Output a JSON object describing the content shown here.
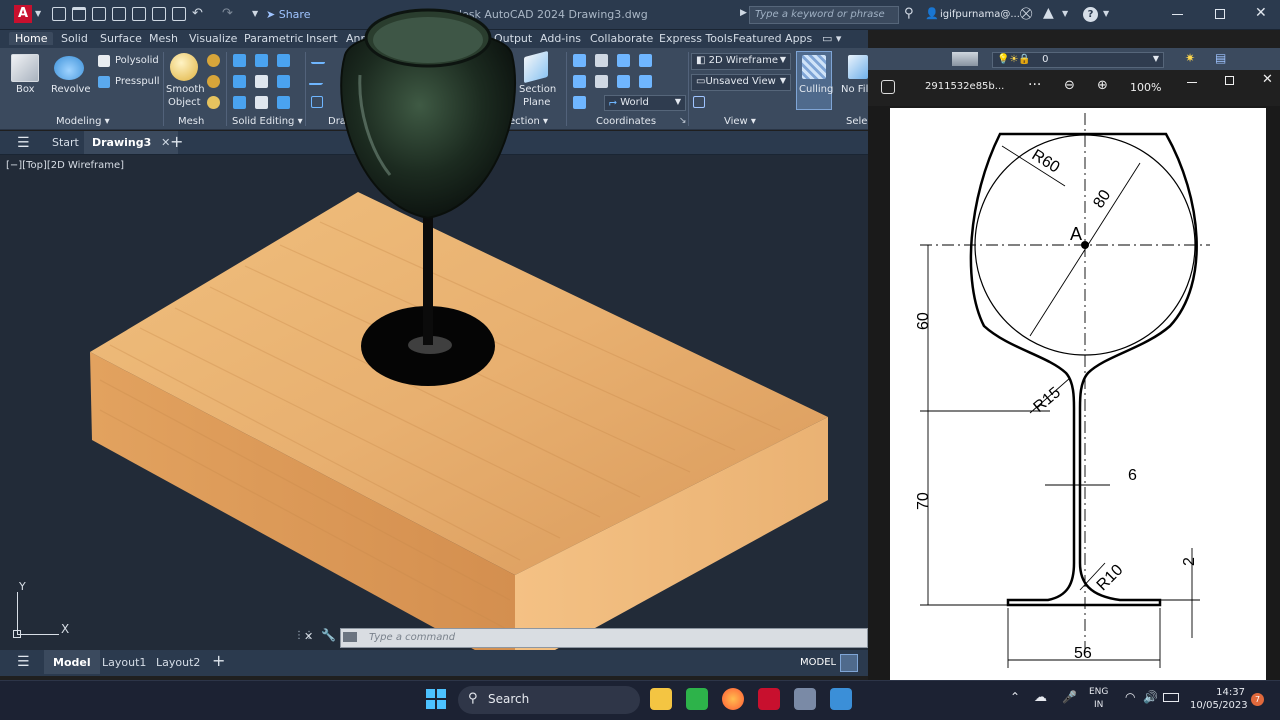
{
  "app": {
    "title": "Autodesk AutoCAD 2024  Drawing3.dwg",
    "title_visible": "desk AutoCAD 2024    Drawing3.dwg",
    "logo": "A",
    "share": "Share",
    "search_placeholder": "Type a keyword or phrase",
    "user": "igifpurnama@...",
    "help": "?"
  },
  "ribbon_tabs": [
    "Home",
    "Solid",
    "Surface",
    "Mesh",
    "Visualize",
    "Parametric",
    "Insert",
    "Ann",
    "Output",
    "Add-ins",
    "Collaborate",
    "Express Tools",
    "Featured Apps"
  ],
  "ribbon": {
    "box": "Box",
    "revolve": "Revolve",
    "polysolid": "Polysolid",
    "presspull": "Presspull",
    "smooth_object_1": "Smooth",
    "smooth_object_2": "Object",
    "section_plane_1": "Section",
    "section_plane_2": "Plane",
    "visual_style": "2D Wireframe",
    "view_state": "Unsaved View",
    "ucs": "World",
    "culling": "Culling",
    "no_filter": "No Fil",
    "layer": "0",
    "groups": {
      "modeling": "Modeling",
      "mesh": "Mesh",
      "solid_editing": "Solid Editing",
      "draw": "Dra",
      "section": "ection",
      "coordinates": "Coordinates",
      "view": "View",
      "selection": "Selec"
    }
  },
  "doc_tabs": {
    "start": "Start",
    "drawing": "Drawing3"
  },
  "viewport": {
    "label": "[−][Top][2D Wireframe]",
    "ucs_y": "Y",
    "ucs_x": "X"
  },
  "command_placeholder": "Type a command",
  "layout_tabs": [
    "Model",
    "Layout1",
    "Layout2"
  ],
  "status": {
    "model": "MODEL"
  },
  "pdf": {
    "filename": "2911532e85b...",
    "more": "···",
    "zoom": "100%"
  },
  "drawing": {
    "r60": "R60",
    "d80": "80",
    "point_a": "A",
    "dim60": "60",
    "r15": "R15",
    "dim6": "6",
    "dim70": "70",
    "r10": "R10",
    "dim2": "2",
    "dim56": "56"
  },
  "taskbar": {
    "search": "Search",
    "lang_1": "ENG",
    "lang_2": "IN",
    "time": "14:37",
    "date": "10/05/2023",
    "notif": "7"
  }
}
